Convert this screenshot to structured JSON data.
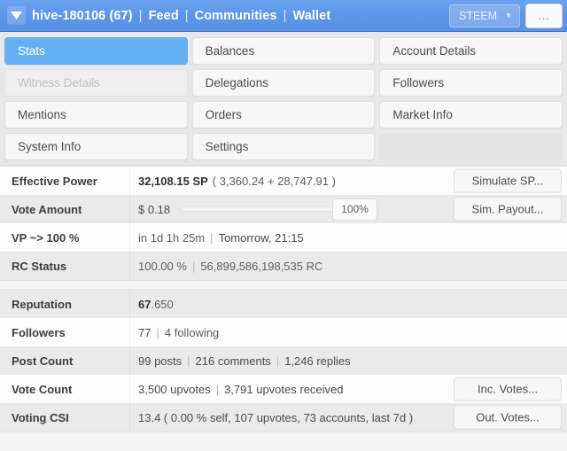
{
  "header": {
    "caret_icon": "triangle-down-icon",
    "account": "hive-180106 (67)",
    "links": [
      "Feed",
      "Communities",
      "Wallet"
    ],
    "separator": "|",
    "chain_selector": {
      "label": "STEEM",
      "caret_icon": "triangle-down-icon"
    },
    "overflow_button": "...",
    "accent_color": "#5b95e8"
  },
  "tabs": {
    "active_color": "#64b0f2",
    "items": [
      {
        "label": "Stats",
        "state": "active"
      },
      {
        "label": "Balances",
        "state": "normal"
      },
      {
        "label": "Account Details",
        "state": "normal"
      },
      {
        "label": "Witness Details",
        "state": "disabled"
      },
      {
        "label": "Delegations",
        "state": "normal"
      },
      {
        "label": "Followers",
        "state": "normal"
      },
      {
        "label": "Mentions",
        "state": "normal"
      },
      {
        "label": "Orders",
        "state": "normal"
      },
      {
        "label": "Market Info",
        "state": "normal"
      },
      {
        "label": "System Info",
        "state": "normal"
      },
      {
        "label": "Settings",
        "state": "normal"
      },
      {
        "label": "",
        "state": "empty"
      }
    ]
  },
  "stats": {
    "group_one": {
      "effective_power": {
        "label": "Effective Power",
        "amount": "32,108.15 SP",
        "breakdown": "( 3,360.24 + 28,747.91 )",
        "button": "Simulate SP..."
      },
      "vote_amount": {
        "label": "Vote Amount",
        "amount": "$ 0.18",
        "slider_percent": "100%",
        "button": "Sim. Payout..."
      },
      "vp_full": {
        "label": "VP ~> 100 %",
        "relative": "in 1d 1h 25m",
        "separator": "|",
        "absolute": "Tomorrow, 21:15"
      },
      "rc_status": {
        "label": "RC Status",
        "percent": "100.00 %",
        "separator": "|",
        "amount": "56,899,586,198,535 RC"
      }
    },
    "group_two": {
      "reputation": {
        "label": "Reputation",
        "value_int": "67",
        "value_frac": ".650"
      },
      "followers": {
        "label": "Followers",
        "count": "77",
        "separator": "|",
        "following": "4 following"
      },
      "post_count": {
        "label": "Post Count",
        "posts": "99 posts",
        "sep1": "|",
        "comments": "216 comments",
        "sep2": "|",
        "replies": "1,246 replies"
      },
      "vote_count": {
        "label": "Vote Count",
        "given": "3,500 upvotes",
        "separator": "|",
        "received": "3,791 upvotes received",
        "button": "Inc. Votes..."
      },
      "voting_csi": {
        "label": "Voting CSI",
        "value": "13.4 ( 0.00 % self, 107 upvotes, 73 accounts, last 7d )",
        "button": "Out. Votes..."
      }
    }
  }
}
